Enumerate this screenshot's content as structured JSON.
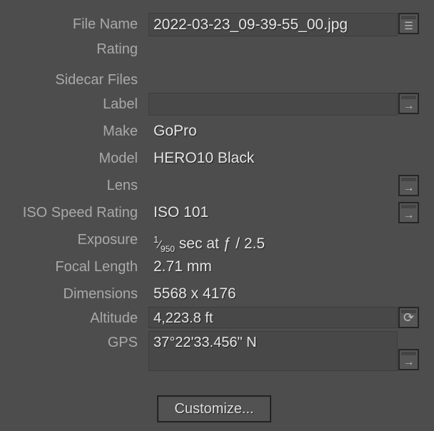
{
  "labels": {
    "file_name": "File Name",
    "rating": "Rating",
    "sidecar": "Sidecar Files",
    "label": "Label",
    "make": "Make",
    "model": "Model",
    "lens": "Lens",
    "iso": "ISO Speed Rating",
    "exposure": "Exposure",
    "focal": "Focal Length",
    "dimensions": "Dimensions",
    "altitude": "Altitude",
    "gps": "GPS"
  },
  "values": {
    "file_name": "2022-03-23_09-39-55_00.jpg",
    "label": "",
    "make": "GoPro",
    "model": "HERO10 Black",
    "lens": "",
    "iso": "ISO 101",
    "exposure_num": "1",
    "exposure_den": "950",
    "exposure_rest": " sec at ƒ / 2.5",
    "focal": "2.71 mm",
    "dimensions": "5568 x 4176",
    "altitude": "4,223.8 ft",
    "gps": "37°22'33.456\" N"
  },
  "buttons": {
    "customize": "Customize..."
  }
}
